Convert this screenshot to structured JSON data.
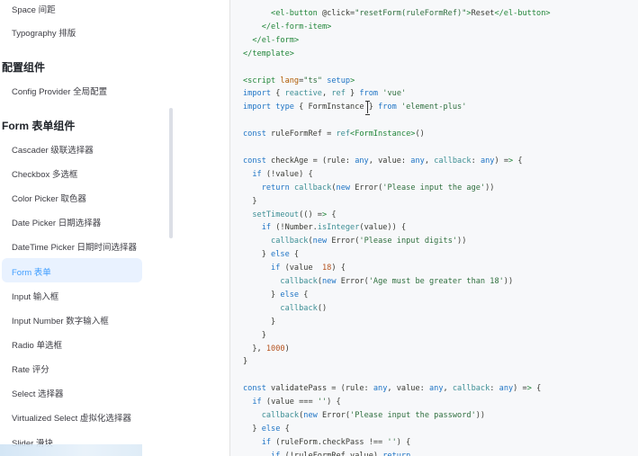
{
  "sidebar": {
    "items": [
      {
        "label": "Space 间距"
      },
      {
        "label": "Typography 排版"
      },
      {
        "label": "配置组件"
      },
      {
        "label": "Config Provider 全局配置"
      },
      {
        "label": "Form 表单组件"
      },
      {
        "label": "Cascader 级联选择器"
      },
      {
        "label": "Checkbox 多选框"
      },
      {
        "label": "Color Picker 取色器"
      },
      {
        "label": "Date Picker 日期选择器"
      },
      {
        "label": "DateTime Picker 日期时间选择器"
      },
      {
        "label": "Form 表单"
      },
      {
        "label": "Input 输入框"
      },
      {
        "label": "Input Number 数字输入框"
      },
      {
        "label": "Radio 单选框"
      },
      {
        "label": "Rate 评分"
      },
      {
        "label": "Select 选择器"
      },
      {
        "label": "Virtualized Select 虚拟化选择器"
      },
      {
        "label": "Slider 滑块"
      }
    ],
    "active_color": "#409eff"
  },
  "code": {
    "lines": [
      "      <el-button @click=\"resetForm(ruleFormRef)\">Reset</el-button>",
      "    </el-form-item>",
      "  </el-form>",
      "</template>",
      "",
      "<script lang=\"ts\" setup>",
      "import { reactive, ref } from 'vue'",
      "import type { FormInstance } from 'element-plus'",
      "",
      "const ruleFormRef = ref<FormInstance>()",
      "",
      "const checkAge = (rule: any, value: any, callback: any) => {",
      "  if (!value) {",
      "    return callback(new Error('Please input the age'))",
      "  }",
      "  setTimeout(() => {",
      "    if (!Number.isInteger(value)) {",
      "      callback(new Error('Please input digits'))",
      "    } else {",
      "      if (value < 18) {",
      "        callback(new Error('Age must be greater than 18'))",
      "      } else {",
      "        callback()",
      "      }",
      "    }",
      "  }, 1000)",
      "}",
      "",
      "const validatePass = (rule: any, value: any, callback: any) => {",
      "  if (value === '') {",
      "    callback(new Error('Please input the password'))",
      "  } else {",
      "    if (ruleForm.checkPass !== '') {",
      "      if (!ruleFormRef.value) return"
    ]
  }
}
